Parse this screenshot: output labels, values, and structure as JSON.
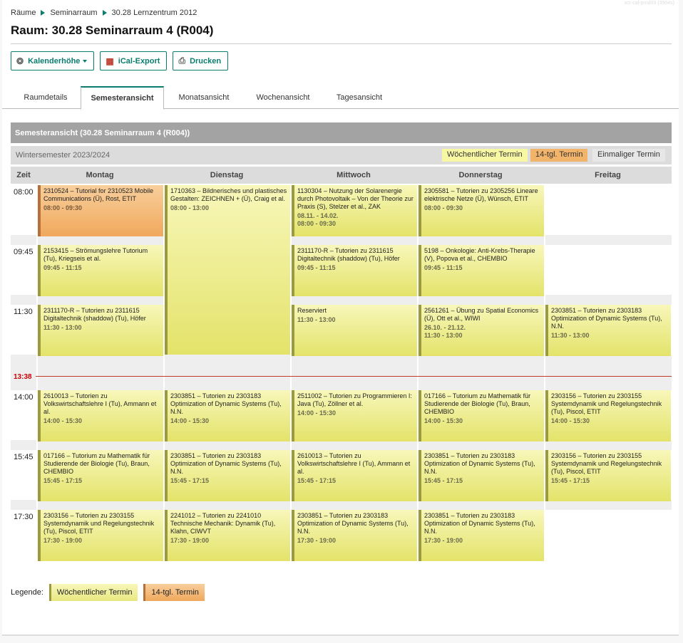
{
  "corner_text": "scr-cal-prod03 (3904s)",
  "breadcrumbs": [
    "Räume",
    "Seminarraum",
    "30.28 Lernzentrum 2012"
  ],
  "page_title": "Raum: 30.28 Seminarraum 4 (R004)",
  "toolbar": {
    "calendar_height": "Kalenderhöhe",
    "ical_export": "iCal-Export",
    "print": "Drucken"
  },
  "tabs": [
    "Raumdetails",
    "Semesteransicht",
    "Monatsansicht",
    "Wochenansicht",
    "Tagesansicht"
  ],
  "active_tab": "Semesteransicht",
  "calendar": {
    "header": "Semesteransicht (30.28 Seminarraum 4 (R004))",
    "semester": "Wintersemester 2023/2024",
    "legend_weekly": "Wöchentlicher Termin",
    "legend_biweekly": "14-tgl. Termin",
    "legend_once": "Einmaliger Termin",
    "col_time": "Zeit",
    "days": [
      "Montag",
      "Dienstag",
      "Mittwoch",
      "Donnerstag",
      "Freitag"
    ],
    "times": [
      "08:00",
      "09:45",
      "11:30",
      "14:00",
      "15:45",
      "17:30"
    ],
    "now_label": "13:38",
    "events": [
      {
        "day": 0,
        "row": 0,
        "kind": "biweekly",
        "title": "2310524 – Tutorial for 2310523 Mobile Communications (Ü), Rost, ETIT",
        "time": "08:00 - 09:30"
      },
      {
        "day": 1,
        "row": 0,
        "kind": "weekly",
        "span": "long",
        "title": "1710363 – Bildnerisches und plastisches Gestalten: ZEICHNEN + (Ü), Craig et al.",
        "time": "08:00 - 13:00"
      },
      {
        "day": 2,
        "row": 0,
        "kind": "weekly",
        "title": "1130304 – Nutzung der Solarenergie durch Photovoltaik – Von der Theorie zur Praxis (S), Stelzer et al., ZAK",
        "dates": "08.11. - 14.02.",
        "time": "08:00 - 09:30"
      },
      {
        "day": 3,
        "row": 0,
        "kind": "weekly",
        "title": "2305581 – Tutorien zu 2305256 Lineare elektrische Netze (Ü), Wünsch, ETIT",
        "time": "08:00 - 09:30"
      },
      {
        "day": 0,
        "row": 1,
        "kind": "weekly",
        "title": "2153415 – Strömungslehre Tutorium (Tu), Kriegseis et al.",
        "time": "09:45 - 11:15"
      },
      {
        "day": 2,
        "row": 1,
        "kind": "weekly",
        "title": "2311170-R – Tutorien zu 2311615 Digitaltechnik (shaddow) (Tu), Höfer",
        "time": "09:45 - 11:15"
      },
      {
        "day": 3,
        "row": 1,
        "kind": "weekly",
        "title": "5198 – Onkologie: Anti-Krebs-Therapie (V), Popova et al., CHEMBIO",
        "time": "09:45 - 11:15"
      },
      {
        "day": 0,
        "row": 2,
        "kind": "weekly",
        "title": "2311170-R – Tutorien zu 2311615 Digitaltechnik (shaddow) (Tu), Höfer",
        "time": "11:30 - 13:00"
      },
      {
        "day": 2,
        "row": 2,
        "kind": "weekly",
        "title": "Reserviert",
        "time": "11:30 - 13:00"
      },
      {
        "day": 3,
        "row": 2,
        "kind": "weekly",
        "title": "2561261 – Übung zu Spatial Economics (Ü), Ott et al., WIWI",
        "dates": "26.10. - 21.12.",
        "time": "11:30 - 13:00"
      },
      {
        "day": 4,
        "row": 2,
        "kind": "weekly",
        "title": "2303851 – Tutorien zu 2303183 Optimization of Dynamic Systems (Tu), N.N.",
        "time": "11:30 - 13:00"
      },
      {
        "day": 0,
        "row": 3,
        "kind": "weekly",
        "title": "2610013 – Tutorien zu Volkswirtschaftslehre I (Tu), Ammann et al.",
        "time": "14:00 - 15:30"
      },
      {
        "day": 1,
        "row": 3,
        "kind": "weekly",
        "title": "2303851 – Tutorien zu 2303183 Optimization of Dynamic Systems (Tu), N.N.",
        "time": "14:00 - 15:30"
      },
      {
        "day": 2,
        "row": 3,
        "kind": "weekly",
        "title": "2511002 – Tutorien zu Programmieren I: Java (Tu), Zöllner et al.",
        "time": "14:00 - 15:30"
      },
      {
        "day": 3,
        "row": 3,
        "kind": "weekly",
        "title": "017166 – Tutorium zu Mathematik für Studierende der Biologie (Tu), Braun, CHEMBIO",
        "time": "14:00 - 15:30"
      },
      {
        "day": 4,
        "row": 3,
        "kind": "weekly",
        "title": "2303156 – Tutorien zu 2303155 Systemdynamik und Regelungstechnik (Tu), Piscol, ETIT",
        "time": "14:00 - 15:30"
      },
      {
        "day": 0,
        "row": 4,
        "kind": "weekly",
        "title": "017166 – Tutorium zu Mathematik für Studierende der Biologie (Tu), Braun, CHEMBIO",
        "time": "15:45 - 17:15"
      },
      {
        "day": 1,
        "row": 4,
        "kind": "weekly",
        "title": "2303851 – Tutorien zu 2303183 Optimization of Dynamic Systems (Tu), N.N.",
        "time": "15:45 - 17:15"
      },
      {
        "day": 2,
        "row": 4,
        "kind": "weekly",
        "title": "2610013 – Tutorien zu Volkswirtschaftslehre I (Tu), Ammann et al.",
        "time": "15:45 - 17:15"
      },
      {
        "day": 3,
        "row": 4,
        "kind": "weekly",
        "title": "2303851 – Tutorien zu 2303183 Optimization of Dynamic Systems (Tu), N.N.",
        "time": "15:45 - 17:15"
      },
      {
        "day": 4,
        "row": 4,
        "kind": "weekly",
        "title": "2303156 – Tutorien zu 2303155 Systemdynamik und Regelungstechnik (Tu), Piscol, ETIT",
        "time": "15:45 - 17:15"
      },
      {
        "day": 0,
        "row": 5,
        "kind": "weekly",
        "title": "2303156 – Tutorien zu 2303155 Systemdynamik und Regelungstechnik (Tu), Piscol, ETIT",
        "time": "17:30 - 19:00"
      },
      {
        "day": 1,
        "row": 5,
        "kind": "weekly",
        "title": "2241012 – Tutorien zu 2241010 Technische Mechanik: Dynamik (Tu), Klahn, CIWVT",
        "time": "17:30 - 19:00"
      },
      {
        "day": 2,
        "row": 5,
        "kind": "weekly",
        "title": "2303851 – Tutorien zu 2303183 Optimization of Dynamic Systems (Tu), N.N.",
        "time": "17:30 - 19:00"
      },
      {
        "day": 3,
        "row": 5,
        "kind": "weekly",
        "title": "2303851 – Tutorien zu 2303183 Optimization of Dynamic Systems (Tu), N.N.",
        "time": "17:30 - 19:00"
      }
    ]
  },
  "legend": {
    "label": "Legende:",
    "weekly": "Wöchentlicher Termin",
    "biweekly": "14-tgl. Termin"
  },
  "colors": {
    "accent": "#0a7d6e",
    "weekly": "#f8f7a4",
    "biweekly": "#f2b36b",
    "once": "#e7e7e7",
    "now_line": "#c0392b"
  }
}
